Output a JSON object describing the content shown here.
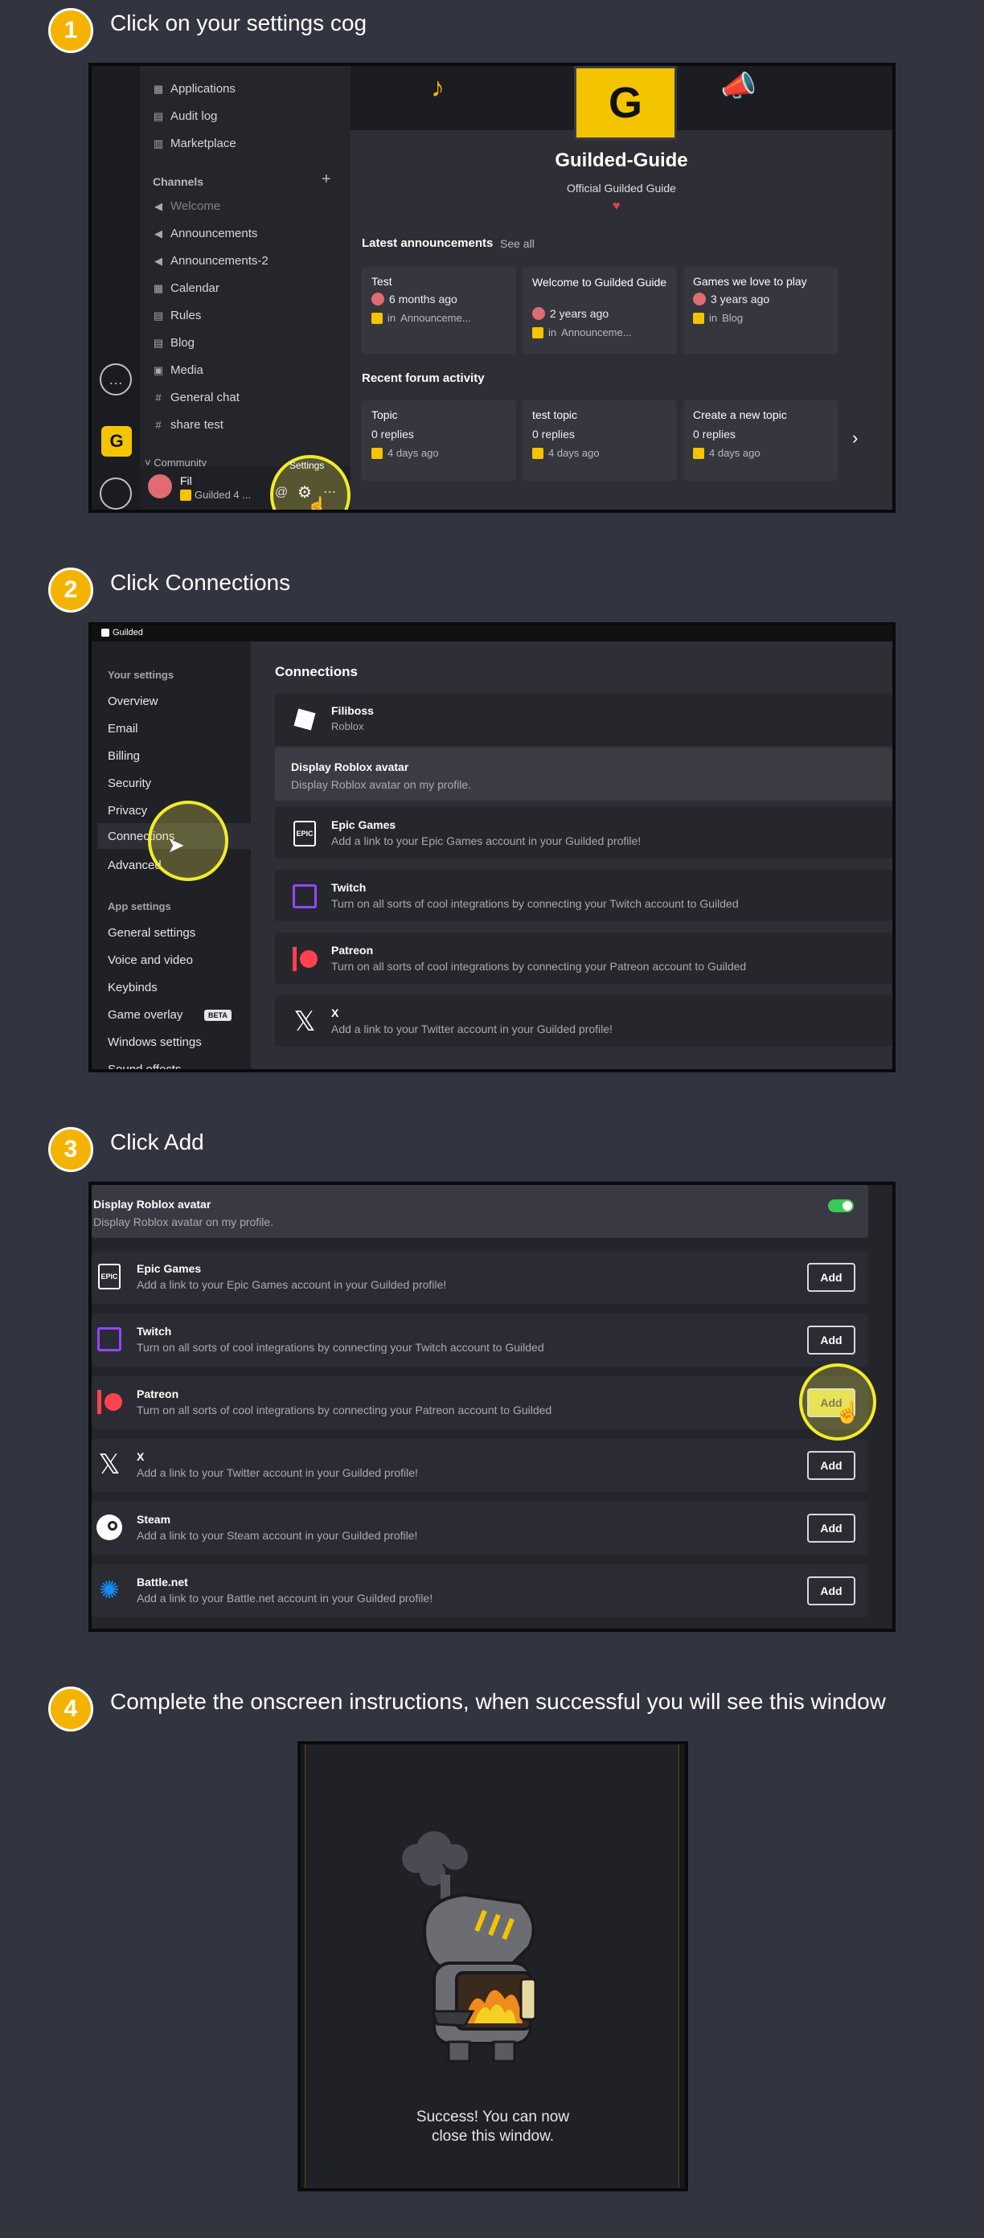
{
  "steps": [
    {
      "num": "1",
      "title": "Click on your settings cog"
    },
    {
      "num": "2",
      "title": "Click Connections"
    },
    {
      "num": "3",
      "title": "Click Add"
    },
    {
      "num": "4",
      "title": "Complete the onscreen instructions, when successful you will see this window"
    }
  ],
  "shot1": {
    "sidebar_items_top": [
      "Applications",
      "Audit log",
      "Marketplace"
    ],
    "channels_header": "Channels",
    "channels_add": "+",
    "channels": [
      {
        "icon": "megaphone-icon",
        "label": "Welcome"
      },
      {
        "icon": "megaphone-icon",
        "label": "Announcements"
      },
      {
        "icon": "megaphone-icon",
        "label": "Announcements-2"
      },
      {
        "icon": "calendar-icon",
        "label": "Calendar"
      },
      {
        "icon": "doc-icon",
        "label": "Rules"
      },
      {
        "icon": "doc-icon",
        "label": "Blog"
      },
      {
        "icon": "media-icon",
        "label": "Media"
      },
      {
        "icon": "hash-icon",
        "label": "General chat"
      },
      {
        "icon": "hash-icon",
        "label": "share test"
      }
    ],
    "community_label": "Community",
    "user_name": "Fil",
    "user_status": "Guilded 4 ...",
    "settings_tooltip": "Settings",
    "server_name": "Guilded-Guide",
    "server_desc": "Official Guilded Guide",
    "announcements_header": "Latest announcements",
    "see_all": "See all",
    "announcements": [
      {
        "title": "Test",
        "time": "6 months ago",
        "channel": "Announceme..."
      },
      {
        "title": "Welcome to Guilded Guide",
        "time": "2 years ago",
        "channel": "Announceme..."
      },
      {
        "title": "Games we love to play",
        "time": "3 years ago",
        "channel": "Blog"
      }
    ],
    "forum_header": "Recent forum activity",
    "forum": [
      {
        "title": "Topic",
        "replies": "0 replies",
        "time": "4 days ago"
      },
      {
        "title": "test topic",
        "replies": "0 replies",
        "time": "4 days ago"
      },
      {
        "title": "Create a new topic",
        "replies": "0 replies",
        "time": "4 days ago"
      }
    ],
    "in_label": "in"
  },
  "shot2": {
    "brand": "Guilded",
    "your_settings": "Your settings",
    "nav": [
      "Overview",
      "Email",
      "Billing",
      "Security",
      "Privacy",
      "Connections",
      "Advanced"
    ],
    "app_settings": "App settings",
    "app_nav": [
      "General settings",
      "Voice and video",
      "Keybinds",
      "Game overlay",
      "Windows settings",
      "Sound effects"
    ],
    "beta_badge": "BETA",
    "page_title": "Connections",
    "roblox_name": "Filiboss",
    "roblox_sub": "Roblox",
    "roblox_avatar_title": "Display Roblox avatar",
    "roblox_avatar_desc": "Display Roblox avatar on my profile.",
    "connections": [
      {
        "name": "Epic Games",
        "desc": "Add a link to your Epic Games account in your Guilded profile!"
      },
      {
        "name": "Twitch",
        "desc": "Turn on all sorts of cool integrations by connecting your Twitch account to Guilded"
      },
      {
        "name": "Patreon",
        "desc": "Turn on all sorts of cool integrations by connecting your Patreon account to Guilded"
      },
      {
        "name": "X",
        "desc": "Add a link to your Twitter account in your Guilded profile!"
      }
    ]
  },
  "shot3": {
    "roblox_avatar_title": "Display Roblox avatar",
    "roblox_avatar_desc": "Display Roblox avatar on my profile.",
    "add_label": "Add",
    "connections": [
      {
        "name": "Epic Games",
        "desc": "Add a link to your Epic Games account in your Guilded profile!"
      },
      {
        "name": "Twitch",
        "desc": "Turn on all sorts of cool integrations by connecting your Twitch account to Guilded"
      },
      {
        "name": "Patreon",
        "desc": "Turn on all sorts of cool integrations by connecting your Patreon account to Guilded"
      },
      {
        "name": "X",
        "desc": "Add a link to your Twitter account in your Guilded profile!"
      },
      {
        "name": "Steam",
        "desc": "Add a link to your Steam account in your Guilded profile!"
      },
      {
        "name": "Battle.net",
        "desc": "Add a link to your Battle.net account in your Guilded profile!"
      }
    ]
  },
  "shot4": {
    "line1": "Success! You can now",
    "line2": "close this window."
  },
  "colors": {
    "accent": "#f5b301",
    "highlight": "#f0ec2a",
    "guilded_yellow": "#f5c400",
    "toggle_on": "#3ac95a"
  }
}
